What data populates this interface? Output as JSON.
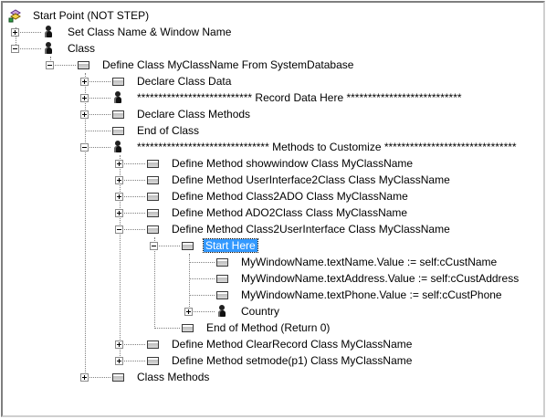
{
  "tree": {
    "root": {
      "label": "Start Point (NOT STEP)",
      "icon": "flow-start-icon"
    },
    "nodes": [
      {
        "label": "Set Class Name & Window Name",
        "icon": "figure-icon",
        "state": "collapsed"
      },
      {
        "label": "Class",
        "icon": "figure-icon",
        "state": "expanded"
      },
      {
        "label": "Define Class MyClassName From SystemDatabase",
        "icon": "step-box-icon",
        "state": "expanded"
      },
      {
        "label": "Declare Class Data",
        "icon": "step-box-icon",
        "state": "collapsed"
      },
      {
        "label": "*************************** Record Data Here ***************************",
        "icon": "figure-icon",
        "state": "collapsed"
      },
      {
        "label": "Declare Class Methods",
        "icon": "step-box-icon",
        "state": "collapsed"
      },
      {
        "label": "End of Class",
        "icon": "step-box-icon",
        "state": "leaf"
      },
      {
        "label": "******************************* Methods to Customize *******************************",
        "icon": "figure-icon",
        "state": "expanded"
      },
      {
        "label": "Define Method showwindow Class MyClassName",
        "icon": "step-box-icon",
        "state": "collapsed"
      },
      {
        "label": "Define Method UserInterface2Class Class MyClassName",
        "icon": "step-box-icon",
        "state": "collapsed"
      },
      {
        "label": "Define Method Class2ADO Class MyClassName",
        "icon": "step-box-icon",
        "state": "collapsed"
      },
      {
        "label": "Define Method ADO2Class Class MyClassName",
        "icon": "step-box-icon",
        "state": "collapsed"
      },
      {
        "label": "Define Method Class2UserInterface Class MyClassName",
        "icon": "step-box-icon",
        "state": "expanded"
      },
      {
        "label": "Start Here",
        "icon": "step-box-icon",
        "state": "expanded",
        "selected": true
      },
      {
        "label": "MyWindowName.textName.Value := self:cCustName",
        "icon": "step-box-icon",
        "state": "leaf"
      },
      {
        "label": "MyWindowName.textAddress.Value := self:cCustAddress",
        "icon": "step-box-icon",
        "state": "leaf"
      },
      {
        "label": "MyWindowName.textPhone.Value := self:cCustPhone",
        "icon": "step-box-icon",
        "state": "leaf"
      },
      {
        "label": "Country",
        "icon": "figure-icon",
        "state": "collapsed"
      },
      {
        "label": "End of Method (Return 0)",
        "icon": "step-box-icon",
        "state": "leaf"
      },
      {
        "label": "Define Method ClearRecord Class MyClassName",
        "icon": "step-box-icon",
        "state": "collapsed"
      },
      {
        "label": "Define Method setmode(p1) Class MyClassName",
        "icon": "step-box-icon",
        "state": "collapsed"
      },
      {
        "label": "Class Methods",
        "icon": "step-box-icon",
        "state": "collapsed"
      }
    ]
  }
}
